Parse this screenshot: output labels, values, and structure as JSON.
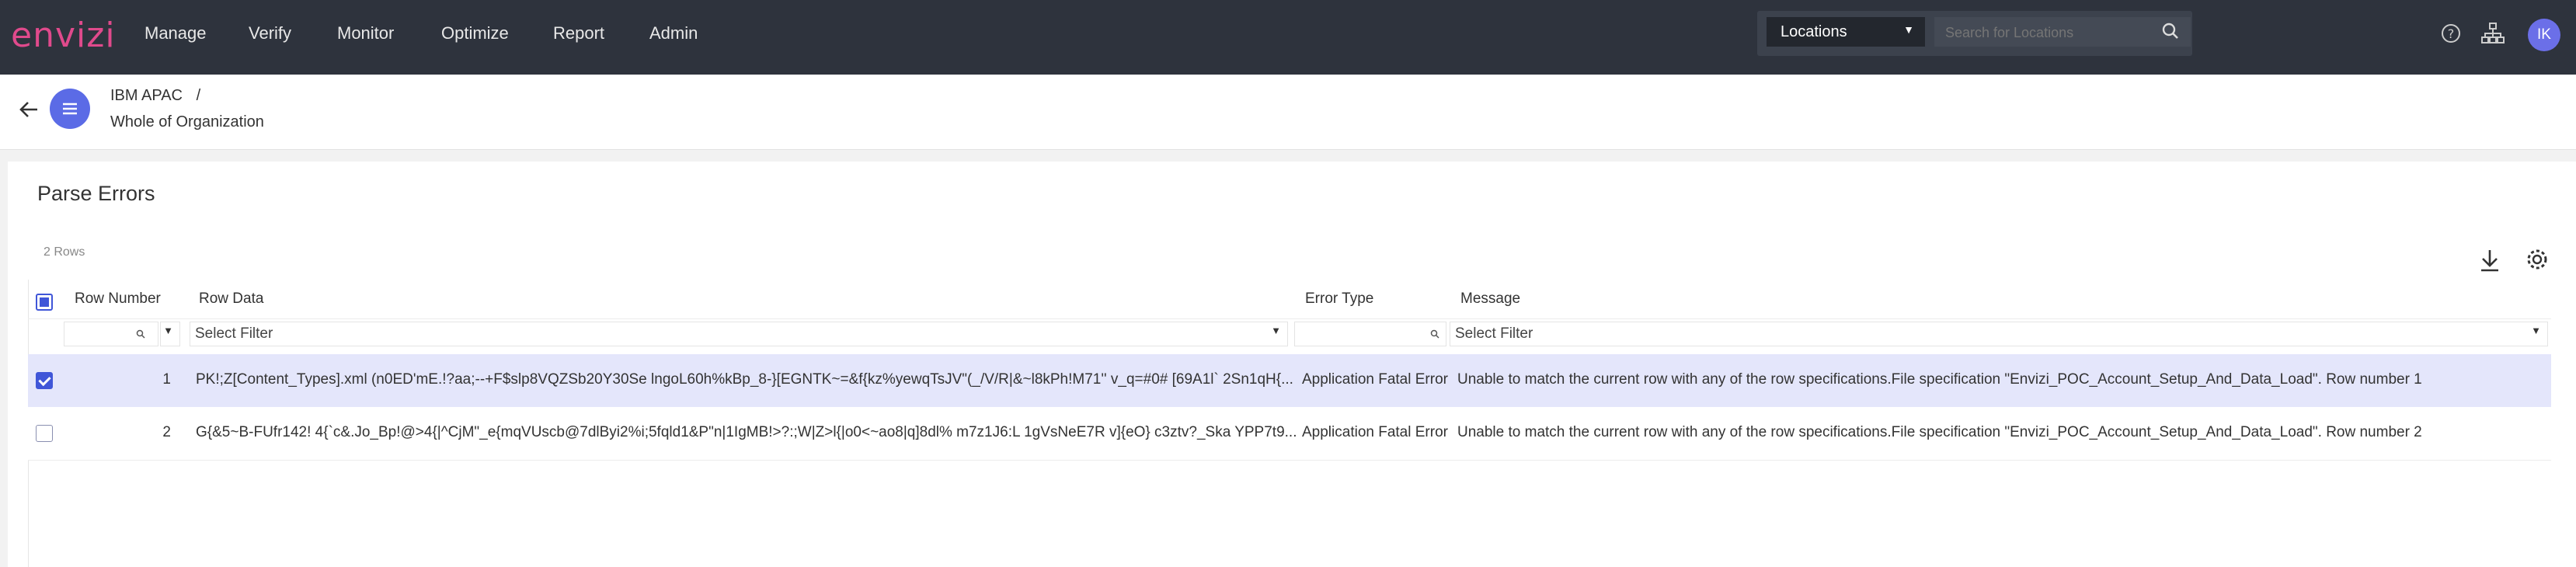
{
  "app": {
    "logo": "envizi"
  },
  "nav": [
    "Manage",
    "Verify",
    "Monitor",
    "Optimize",
    "Report",
    "Admin"
  ],
  "locations": {
    "select_label": "Locations",
    "search_placeholder": "Search for Locations"
  },
  "user": {
    "initials": "IK"
  },
  "breadcrumb": {
    "parent": "IBM APAC",
    "separator": "/",
    "current": "Whole of Organization"
  },
  "page": {
    "title": "Parse Errors",
    "row_count": "2 Rows"
  },
  "table": {
    "columns": {
      "row_number": "Row Number",
      "row_data": "Row Data",
      "error_type": "Error Type",
      "message": "Message"
    },
    "filter_placeholder": "Select Filter",
    "rows": [
      {
        "selected": true,
        "row_number": "1",
        "row_data": "PK!;Z[Content_Types].xml (n0ED'mE.!?aa;--+F$slp8VQZSb20Y30Se lngoL60h%kBp_8-}[EGNTK~=&f{kz%yewqTsJV\"(_/V/R|&~l8kPh!M71'' v_q=#0# [69A1l` 2Sn1qH{...",
        "error_type": "Application Fatal Error",
        "message": "Unable to match the current row with any of the row specifications.File specification \"Envizi_POC_Account_Setup_And_Data_Load\". Row number 1"
      },
      {
        "selected": false,
        "row_number": "2",
        "row_data": "G{&5~B-FUfr142! 4{`c&.Jo_Bp!@>4{|^CjM\"_e{mqVUscb@7dlByi2%i;5fqld1&P\"n|1IgMB!>?:;W|Z>l{|o0<~ao8|q]8dl% m7z1J6:L 1gVsNeE7R v]{eO} c3ztv?_Ska YPP7t9...",
        "error_type": "Application Fatal Error",
        "message": "Unable to match the current row with any of the row specifications.File specification \"Envizi_POC_Account_Setup_And_Data_Load\". Row number 2"
      }
    ]
  },
  "colors": {
    "topbar": "#2e333d",
    "logo": "#e04a8c",
    "accent": "#4056d8",
    "selected_row": "#e4e6fb"
  }
}
